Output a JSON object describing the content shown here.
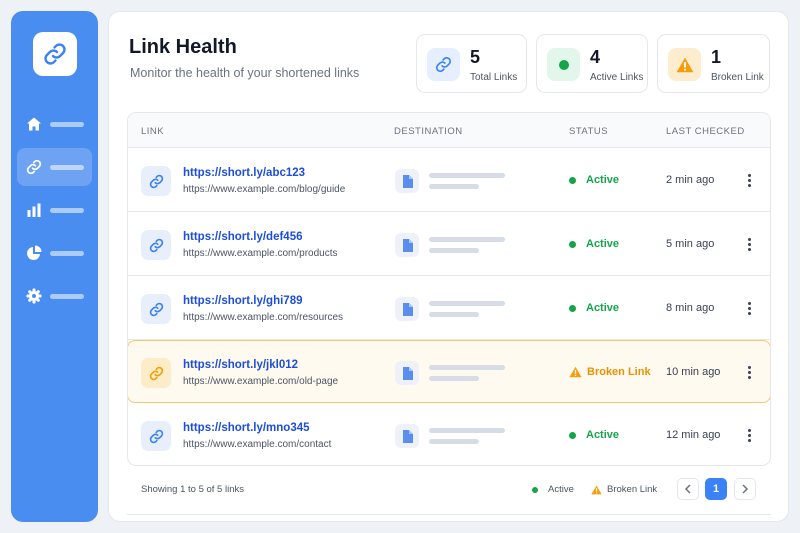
{
  "header": {
    "title": "Link Health",
    "subtitle": "Monitor the health of your shortened links"
  },
  "stats": [
    {
      "value": "5",
      "label": "Total Links",
      "icon": "link-icon"
    },
    {
      "value": "4",
      "label": "Active Links",
      "icon": "green-dot-icon"
    },
    {
      "value": "1",
      "label": "Broken Link",
      "icon": "warning-icon"
    }
  ],
  "sidebar": {
    "items": [
      {
        "icon": "home-icon"
      },
      {
        "icon": "link-icon",
        "active": true
      },
      {
        "icon": "bar-chart-icon"
      },
      {
        "icon": "pie-chart-icon"
      },
      {
        "icon": "gear-icon"
      }
    ]
  },
  "table": {
    "columns": [
      "LINK",
      "DESTINATION",
      "STATUS",
      "LAST CHECKED"
    ],
    "rows": [
      {
        "short": "https://short.ly/abc123",
        "long": "https://www.example.com/blog/guide",
        "status": "Active",
        "checked": "2 min ago"
      },
      {
        "short": "https://short.ly/def456",
        "long": "https://www.example.com/products",
        "status": "Active",
        "checked": "5 min ago"
      },
      {
        "short": "https://short.ly/ghi789",
        "long": "https://www.example.com/resources",
        "status": "Active",
        "checked": "8 min ago"
      },
      {
        "short": "https://short.ly/jkl012",
        "long": "https://www.example.com/old-page",
        "status": "Broken Link",
        "checked": "10 min ago"
      },
      {
        "short": "https://short.ly/mno345",
        "long": "https://www.example.com/contact",
        "status": "Active",
        "checked": "12 min ago"
      }
    ]
  },
  "footer": {
    "showing": "Showing 1 to 5 of 5 links",
    "legend_active": "Active",
    "legend_broken": "Broken Link",
    "current_page": "1"
  },
  "colors": {
    "accent": "#4a8df0",
    "active": "#16a34a",
    "broken": "#e69400",
    "link": "#1d4ed8"
  }
}
